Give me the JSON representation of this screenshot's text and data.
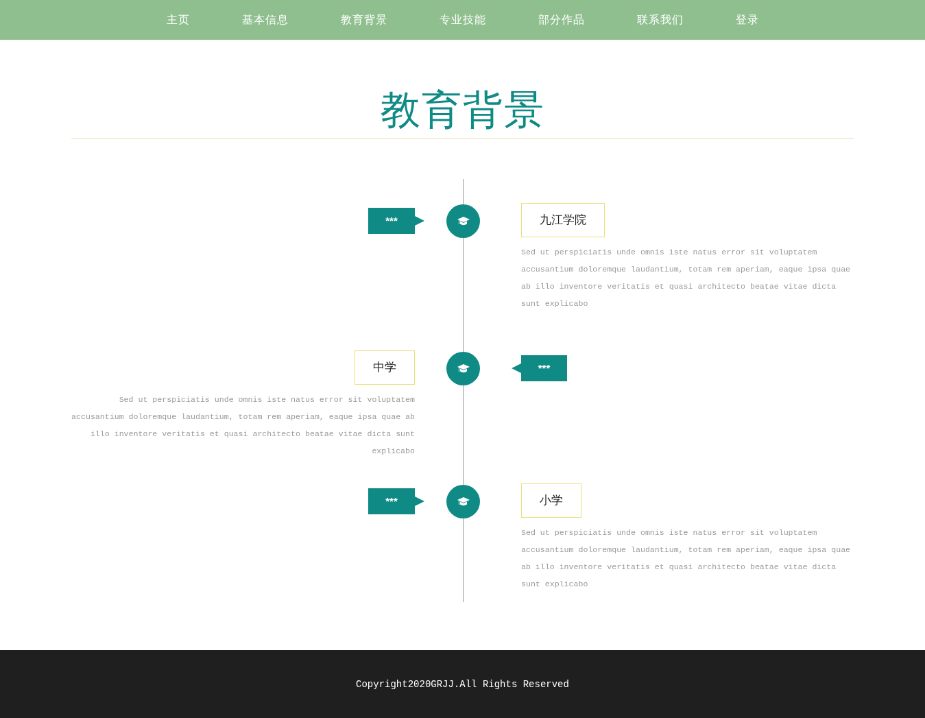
{
  "nav": [
    "主页",
    "基本信息",
    "教育背景",
    "专业技能",
    "部分作品",
    "联系我们",
    "登录"
  ],
  "title": "教育背景",
  "timeline": [
    {
      "kind": "right",
      "tag": "***",
      "school": "九江学院",
      "text": "Sed ut perspiciatis unde omnis iste natus error sit voluptatem accusantium doloremque laudantium, totam rem aperiam, eaque ipsa quae ab illo inventore veritatis et quasi architecto beatae vitae dicta sunt explicabo"
    },
    {
      "kind": "left",
      "tag": "***",
      "school": "中学",
      "text": "Sed ut perspiciatis unde omnis iste natus error sit voluptatem accusantium doloremque laudantium, totam rem aperiam, eaque ipsa quae ab illo inventore veritatis et quasi architecto beatae vitae dicta sunt explicabo"
    },
    {
      "kind": "right",
      "tag": "***",
      "school": "小学",
      "text": "Sed ut perspiciatis unde omnis iste natus error sit voluptatem accusantium doloremque laudantium, totam rem aperiam, eaque ipsa quae ab illo inventore veritatis et quasi architecto beatae vitae dicta sunt explicabo"
    }
  ],
  "footer": "Copyright2020GRJJ.All Rights Reserved"
}
